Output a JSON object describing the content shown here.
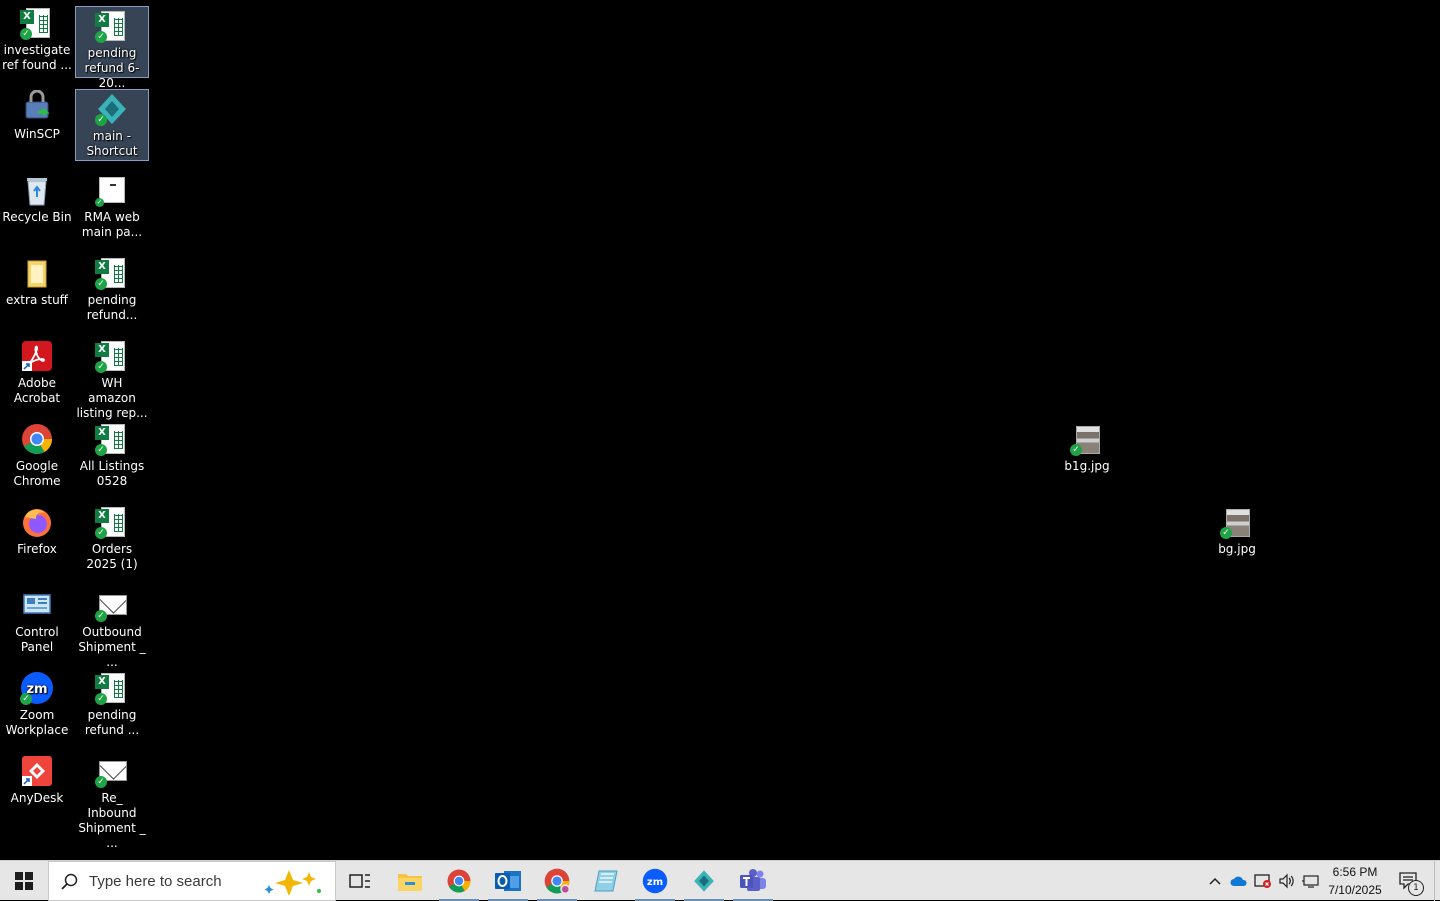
{
  "desktop": {
    "icons": [
      {
        "label": "investigate ref found ..."
      },
      {
        "label": "pending refund 6-20..."
      },
      {
        "label": "WinSCP"
      },
      {
        "label": "main - Shortcut"
      },
      {
        "label": "Recycle Bin"
      },
      {
        "label": "RMA web main pa..."
      },
      {
        "label": "extra stuff"
      },
      {
        "label": "pending refund..."
      },
      {
        "label": "Adobe Acrobat"
      },
      {
        "label": "WH amazon listing rep..."
      },
      {
        "label": "Google Chrome"
      },
      {
        "label": "All Listings 0528"
      },
      {
        "label": "Firefox"
      },
      {
        "label": "Orders 2025 (1)"
      },
      {
        "label": "Control Panel"
      },
      {
        "label": "Outbound Shipment _ ..."
      },
      {
        "label": "Zoom Workplace"
      },
      {
        "label": "pending refund ..."
      },
      {
        "label": "AnyDesk"
      },
      {
        "label": "Re_ Inbound Shipment _ ..."
      },
      {
        "label": "b1g.jpg"
      },
      {
        "label": "bg.jpg"
      }
    ]
  },
  "taskbar": {
    "search_placeholder": "Type here to search",
    "clock_time": "6:56 PM",
    "clock_date": "7/10/2025",
    "notification_count": "1",
    "apps": [
      "task-view",
      "file-explorer",
      "google-chrome",
      "outlook",
      "chrome-profile",
      "paper-app",
      "zoom",
      "main-shortcut-app",
      "microsoft-teams"
    ]
  },
  "colors": {
    "desktop_bg": "#000000",
    "taskbar_bg": "#e6e6e6",
    "excel_green": "#107c41",
    "sync_check": "#1ea446",
    "chrome_red": "#db4437",
    "zoom_blue": "#0b5cff",
    "teams_purple": "#5b5fc7"
  }
}
